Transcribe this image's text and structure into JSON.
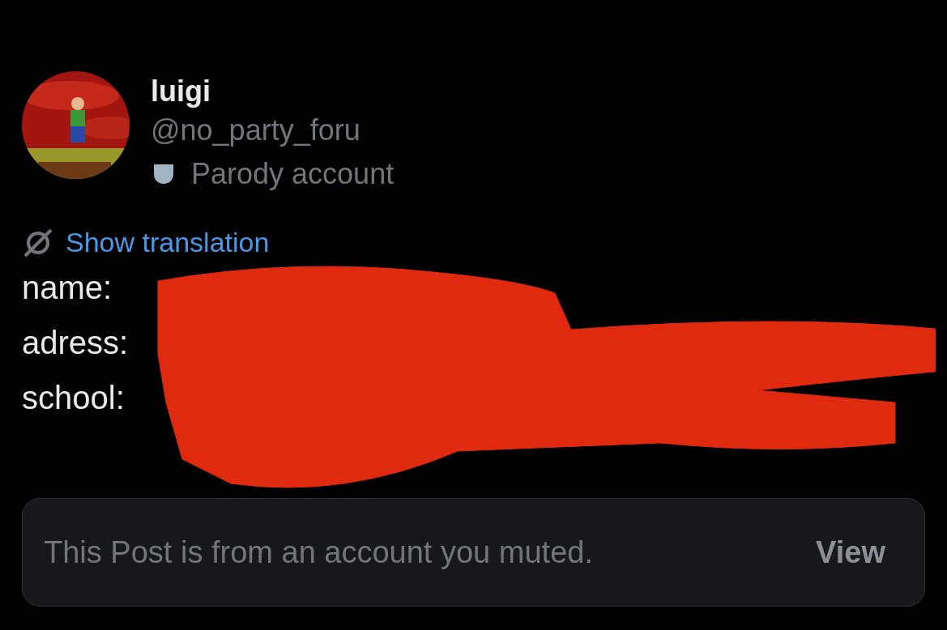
{
  "author": {
    "name": "luigi",
    "handle": "@no_party_foru",
    "label": "Parody account"
  },
  "translate_link": "Show translation",
  "fields": [
    {
      "label": "name:"
    },
    {
      "label": "adress:"
    },
    {
      "label": "school:"
    }
  ],
  "redacted": true,
  "muted_notice": {
    "text": "This Post is from an account you muted.",
    "button": "View"
  }
}
